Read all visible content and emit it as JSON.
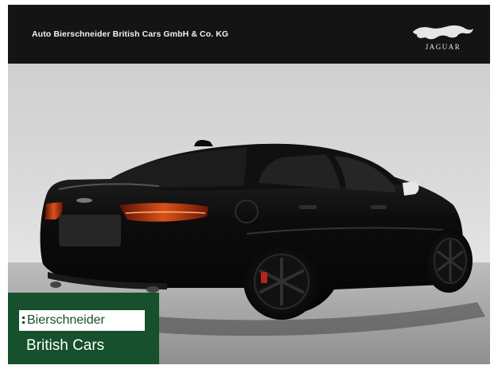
{
  "header": {
    "dealer_name": "Auto Bierschneider British Cars GmbH & Co. KG",
    "brand_logo": "JAGUAR",
    "brand_logo_icon": "jaguar-leaper-icon"
  },
  "photo": {
    "subject": "black Jaguar XE sedan"
  },
  "badge": {
    "line1": "Bierschneider",
    "line2": "British Cars",
    "background_color": "#16502c"
  }
}
